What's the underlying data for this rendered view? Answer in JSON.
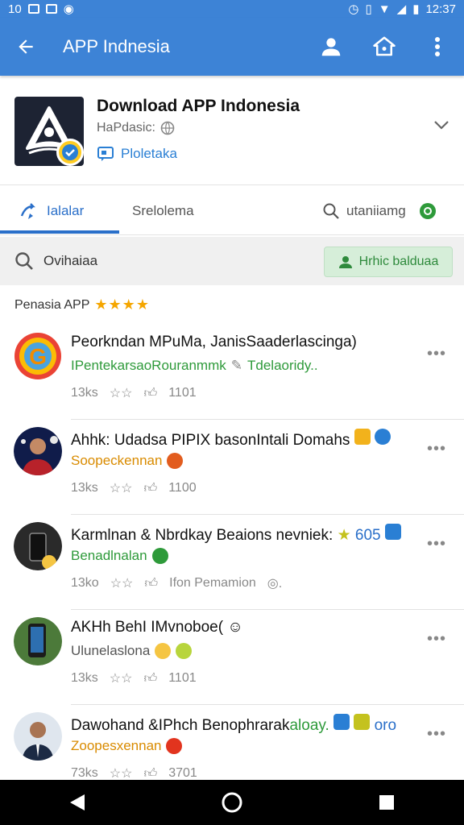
{
  "status": {
    "left_text": "10",
    "time": "12:37"
  },
  "appbar": {
    "title": "APP Indnesia"
  },
  "app": {
    "title": "Download APP Indonesia",
    "subtitle": "HaPdasic:",
    "link": "Ploletaka"
  },
  "tabs": [
    {
      "label": "Ialalar"
    },
    {
      "label": "Srelolema"
    },
    {
      "label": "utaniiamg"
    }
  ],
  "filter": {
    "label": "Ovihaiaa",
    "button": "Hrhic balduaa"
  },
  "section": {
    "title": "Penasia APP",
    "stars": "★★★★"
  },
  "items": [
    {
      "name": "Peorkndan MPuMa, JanisSaaderlascinga)",
      "sub": "IPentekarsaoRouranmmk",
      "sub2": "Tdelaoridy..",
      "sub_color": "green",
      "likes": "13ks",
      "count": "1101"
    },
    {
      "name": "Ahhk: Udadsa PIPIX basonIntali Domahs",
      "sub": "Soopeckennan",
      "sub2": "",
      "sub_color": "orange",
      "likes": "13ks",
      "count": "1100"
    },
    {
      "name": "Karmlnan & Nbrdkay Beaions nevniek:",
      "name_suffix": "605",
      "sub": "Benadlnalan",
      "sub2": "",
      "sub_color": "green",
      "likes": "13ko",
      "count": "Ifon Pemamion"
    },
    {
      "name": "AKHh BehI IMvnoboe(",
      "sub": "Ulunelaslona",
      "sub2": "",
      "sub_color": "gray",
      "likes": "13ks",
      "count": "1101"
    },
    {
      "name": "Dawohand &IPhch Benophrarak",
      "name_suffix": "aloay.",
      "name_suffix2": "oro",
      "sub": "Zoopesxennan",
      "sub2": "",
      "sub_color": "orange",
      "likes": "73ks",
      "count": "3701"
    }
  ]
}
